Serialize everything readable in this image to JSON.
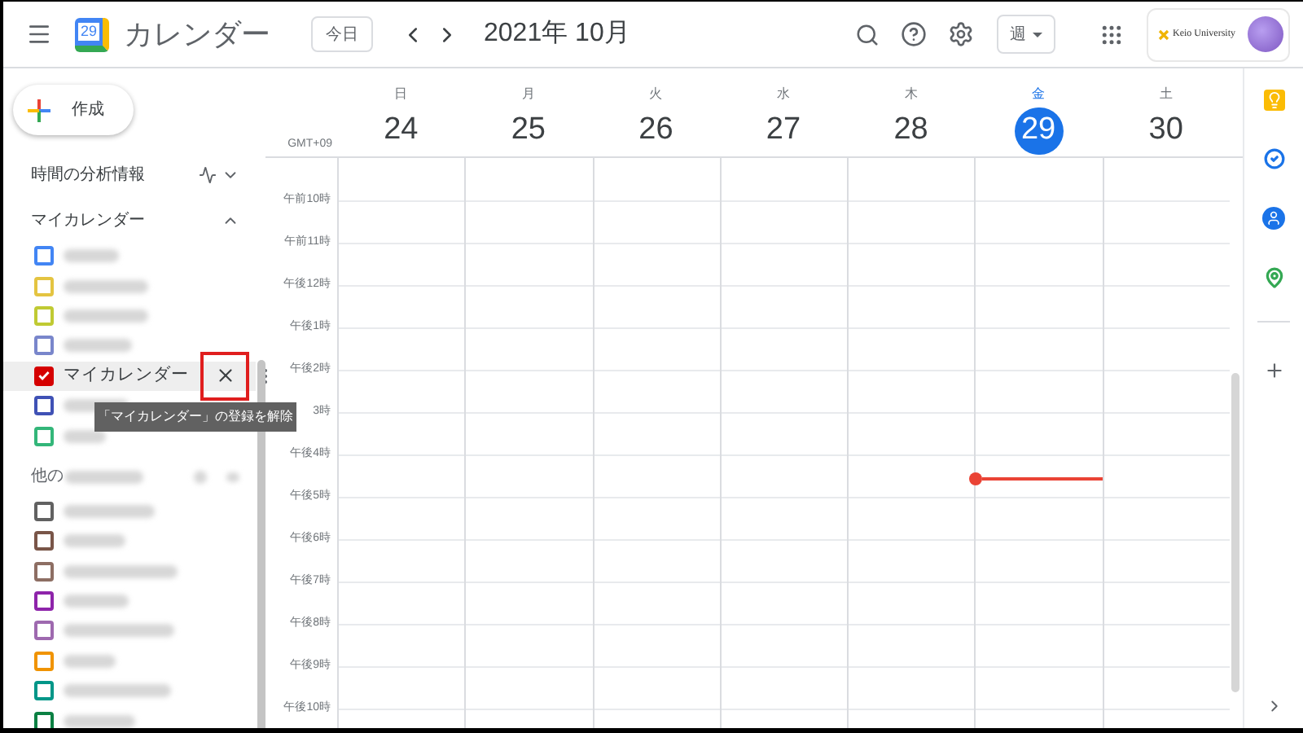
{
  "header": {
    "app_name": "カレンダー",
    "logo_day": "29",
    "today_button": "今日",
    "period": "2021年 10月",
    "view_select": "週",
    "org_name": "Keio University"
  },
  "create_button": "作成",
  "insights": "時間の分析情報",
  "my_calendars": {
    "title": "マイカレンダー",
    "expanded": true,
    "items": [
      {
        "color": "#4285f4",
        "checked": false,
        "label_blurred": true
      },
      {
        "color": "#e4c441",
        "checked": false,
        "label_blurred": true
      },
      {
        "color": "#c0ca33",
        "checked": false,
        "label_blurred": true
      },
      {
        "color": "#7986cb",
        "checked": false,
        "label_blurred": true
      },
      {
        "color": "#d50000",
        "checked": true,
        "label": "マイカレンダー",
        "hovered": true,
        "highlighted_action": true,
        "tooltip": "「マイカレンダー」の登録を解除"
      },
      {
        "color": "#3f51b5",
        "checked": false,
        "label_blurred": true
      },
      {
        "color": "#33b679",
        "checked": false,
        "label_blurred": true
      }
    ]
  },
  "other_calendars": {
    "title": "他の",
    "title_blurred": true,
    "items": [
      {
        "color": "#616161",
        "checked": false,
        "label_blurred": true
      },
      {
        "color": "#795548",
        "checked": false,
        "label_blurred": true
      },
      {
        "color": "#8d6e63",
        "checked": false,
        "label_blurred": true
      },
      {
        "color": "#8e24aa",
        "checked": false,
        "label_blurred": true
      },
      {
        "color": "#9e69af",
        "checked": false,
        "label_blurred": true
      },
      {
        "color": "#f09300",
        "checked": false,
        "label_blurred": true
      },
      {
        "color": "#009688",
        "checked": false,
        "label_blurred": true
      },
      {
        "color": "#0b8043",
        "checked": false,
        "label_blurred": true
      }
    ]
  },
  "timezone": "GMT+09",
  "days": [
    {
      "weekday": "日",
      "date": "24",
      "selected": false
    },
    {
      "weekday": "月",
      "date": "25",
      "selected": false
    },
    {
      "weekday": "火",
      "date": "26",
      "selected": false
    },
    {
      "weekday": "水",
      "date": "27",
      "selected": false
    },
    {
      "weekday": "木",
      "date": "28",
      "selected": false
    },
    {
      "weekday": "金",
      "date": "29",
      "selected": true
    },
    {
      "weekday": "土",
      "date": "30",
      "selected": false
    }
  ],
  "hours": [
    "午前10時",
    "午前11時",
    "午後12時",
    "午後1時",
    "午後2時",
    "3時",
    "午後4時",
    "午後5時",
    "午後6時",
    "午後7時",
    "午後8時",
    "午後9時",
    "午後10時"
  ]
}
